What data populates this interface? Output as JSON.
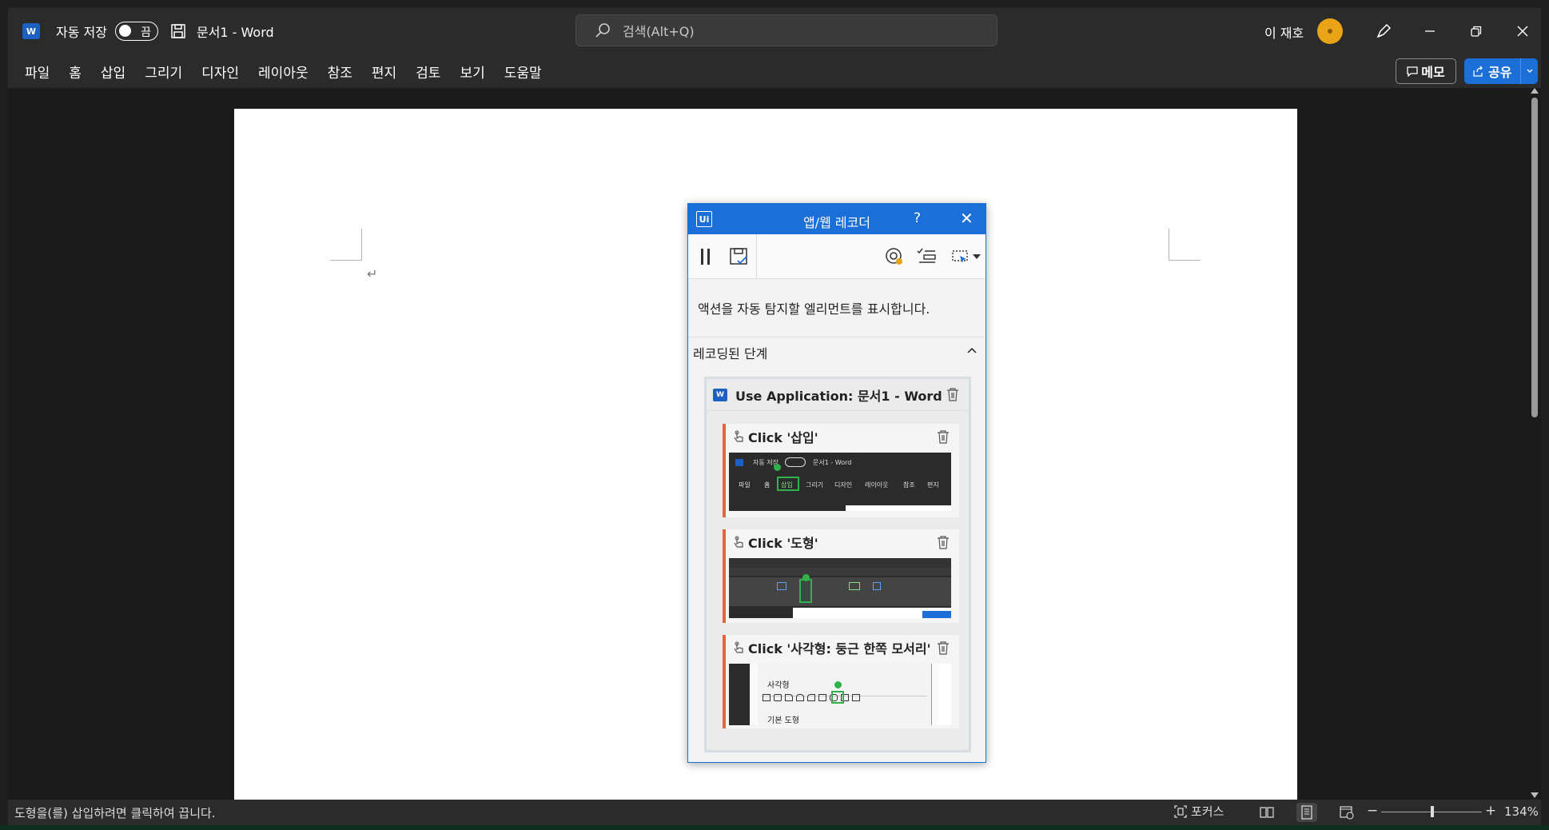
{
  "titlebar": {
    "autosave_label": "자동 저장",
    "toggle_state": "끔",
    "doc_title": "문서1  -  Word",
    "search_placeholder": "검색(Alt+Q)",
    "user_name": "이 재호"
  },
  "menu": {
    "items": [
      "파일",
      "홈",
      "삽입",
      "그리기",
      "디자인",
      "레이아웃",
      "참조",
      "편지",
      "검토",
      "보기",
      "도움말"
    ],
    "memo_label": "메모",
    "share_label": "공유"
  },
  "recorder": {
    "logo": "Ui",
    "title": "앱/웹 레코더",
    "help": "?",
    "hint": "액션을 자동 탐지할 엘리먼트를 표시합니다.",
    "steps_header": "레코딩된 단계",
    "use_app": "Use Application: 문서1 - Word",
    "steps": [
      {
        "label": "Click '삽입'"
      },
      {
        "label": "Click '도형'"
      },
      {
        "label": "Click '사각형: 둥근 한쪽 모서리'"
      }
    ],
    "shot1": {
      "autosave": "자동 저장",
      "toggle": "끔",
      "title": "문서1 - Word",
      "tabs": [
        "파일",
        "홈",
        "삽입",
        "그리기",
        "디자인",
        "레이아웃",
        "참조",
        "편지"
      ]
    },
    "shot3": {
      "group": "사각형",
      "group2": "기본 도형"
    }
  },
  "status": {
    "message": "도형을(를) 삽입하려면 클릭하여 끕니다.",
    "focus": "포커스",
    "zoom": "134%"
  },
  "colors": {
    "accent": "#1b6fd6",
    "step_bar": "#e8643c",
    "highlight": "#2fb24a"
  }
}
